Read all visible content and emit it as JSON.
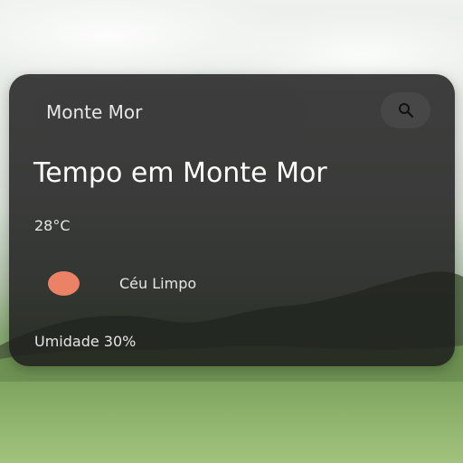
{
  "search": {
    "value": "Monte Mor",
    "button_icon": "search-icon"
  },
  "weather": {
    "title": "Tempo em Monte Mor",
    "temperature": "28°C",
    "description": "Céu Limpo",
    "condition_icon": "sun-icon",
    "humidity": "Umidade 30%"
  },
  "colors": {
    "card_background": "#1c1c1c",
    "input_background": "#3c3c3c",
    "sun": "#ec8265",
    "text": "#ffffff"
  }
}
